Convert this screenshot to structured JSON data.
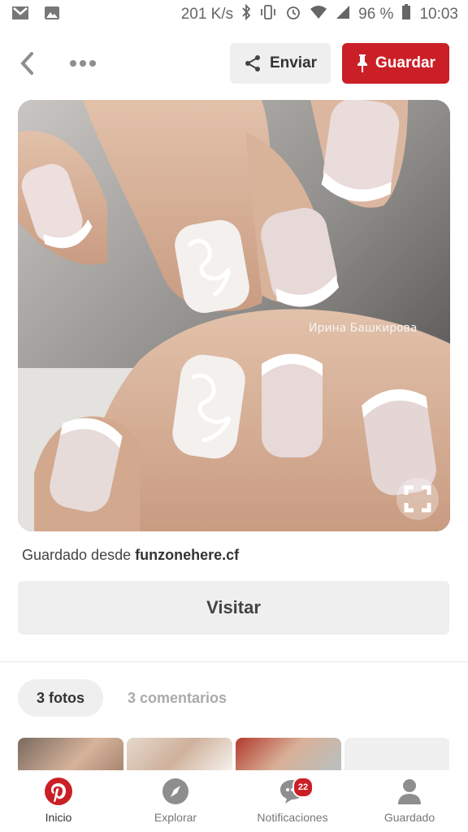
{
  "status_bar": {
    "net_speed": "201 K/s",
    "battery": "96 %",
    "time": "10:03",
    "icons": [
      "gmail-icon",
      "image-icon",
      "bluetooth-icon",
      "vibrate-icon",
      "alarm-icon",
      "wifi-icon",
      "signal-icon",
      "battery-icon"
    ]
  },
  "toolbar": {
    "share_label": "Enviar",
    "save_label": "Guardar"
  },
  "pin": {
    "watermark": "Ирина Башкирова",
    "source_prefix": "Guardado desde",
    "source_domain": "funzonehere.cf",
    "visit_label": "Visitar"
  },
  "tabs": {
    "photos_label": "3 fotos",
    "comments_label": "3 comentarios"
  },
  "nav": {
    "home_label": "Inicio",
    "explore_label": "Explorar",
    "notifications_label": "Notificaciones",
    "notifications_badge": "22",
    "saved_label": "Guardado"
  },
  "colors": {
    "brand_red": "#cb1f27",
    "button_gray": "#efefef"
  }
}
